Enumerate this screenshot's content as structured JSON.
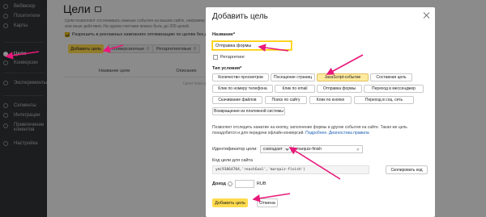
{
  "sidebar": {
    "items": [
      {
        "label": "Вебвизор",
        "icon": "webvisor-icon"
      },
      {
        "label": "Посетители",
        "icon": "visitors-icon"
      },
      {
        "label": "Карты",
        "icon": "maps-icon"
      },
      {
        "label": "Цели",
        "icon": "goals-icon",
        "active": true
      },
      {
        "label": "Конверсии",
        "icon": "conversions-icon"
      },
      {
        "label": "Эксперименты",
        "icon": "experiments-icon"
      },
      {
        "label": "Сегменты",
        "icon": "segments-icon"
      },
      {
        "label": "Интеграции",
        "icon": "integrations-icon"
      },
      {
        "label": "Привлечение клиентов",
        "icon": "acquisition-icon"
      },
      {
        "label": "Настройка",
        "icon": "settings-icon"
      }
    ]
  },
  "page": {
    "title": "Цели",
    "description": "Цели позволяют отслеживать важные события на вашем сайте, например отправку формы или иные действия. На одном счетчике можно быть до 200 целей.",
    "checkbox_label": "Разрешить в рекламных кампаниях оптимизацию по целям без данных",
    "add_button": "Добавить цель",
    "tabs": [
      {
        "label": "Конверсионные",
        "count": "0"
      },
      {
        "label": "Ретаргетинговые",
        "count": "0"
      }
    ],
    "table": {
      "col1": "Название цели",
      "col2": "Описание",
      "hint": "Цели пока не созданы"
    }
  },
  "dialog": {
    "title": "Добавить цель",
    "name_label": "Название*",
    "name_value": "Отправка формы",
    "retargeting_label": "Ретаргетинг",
    "condition_label": "Тип условия*",
    "conditions": [
      "Количество просмотров",
      "Посещение страниц",
      "JavaScript-событие",
      "Составная цель",
      "Клик по номеру телефона",
      "Клик по email",
      "Отправка формы",
      "Переход в мессенджер",
      "Скачивание файлов",
      "Поиск по сайту",
      "Клик по кнопке",
      "Переход в соц. сеть",
      "Возвращение из платежной системы"
    ],
    "selected_condition": "JavaScript-событие",
    "help_text": "Позволяет отследить нажатие на кнопку, заполнение формы и другие события на сайте. Такая же цель понадобится и для передачи офлайн-конверсий.",
    "help_link1": "Подробнее.",
    "help_link2": "Диагностика правила",
    "identifier_label": "Идентификатор цели:",
    "match_select": "совпадает",
    "identifier_value": "marquiz-finish",
    "code_label": "Код цели для сайта",
    "code_value": "ym(91064704,'reachGoal','marquiz-finish')",
    "copy_button": "Скопировать код",
    "income_label": "Доход",
    "currency": "RUB",
    "submit_button": "Добавить цель",
    "cancel_button": "Отмена"
  },
  "colors": {
    "accent": "#ffdb4d",
    "arrow": "#e8187a",
    "sidebar": "#303336"
  }
}
